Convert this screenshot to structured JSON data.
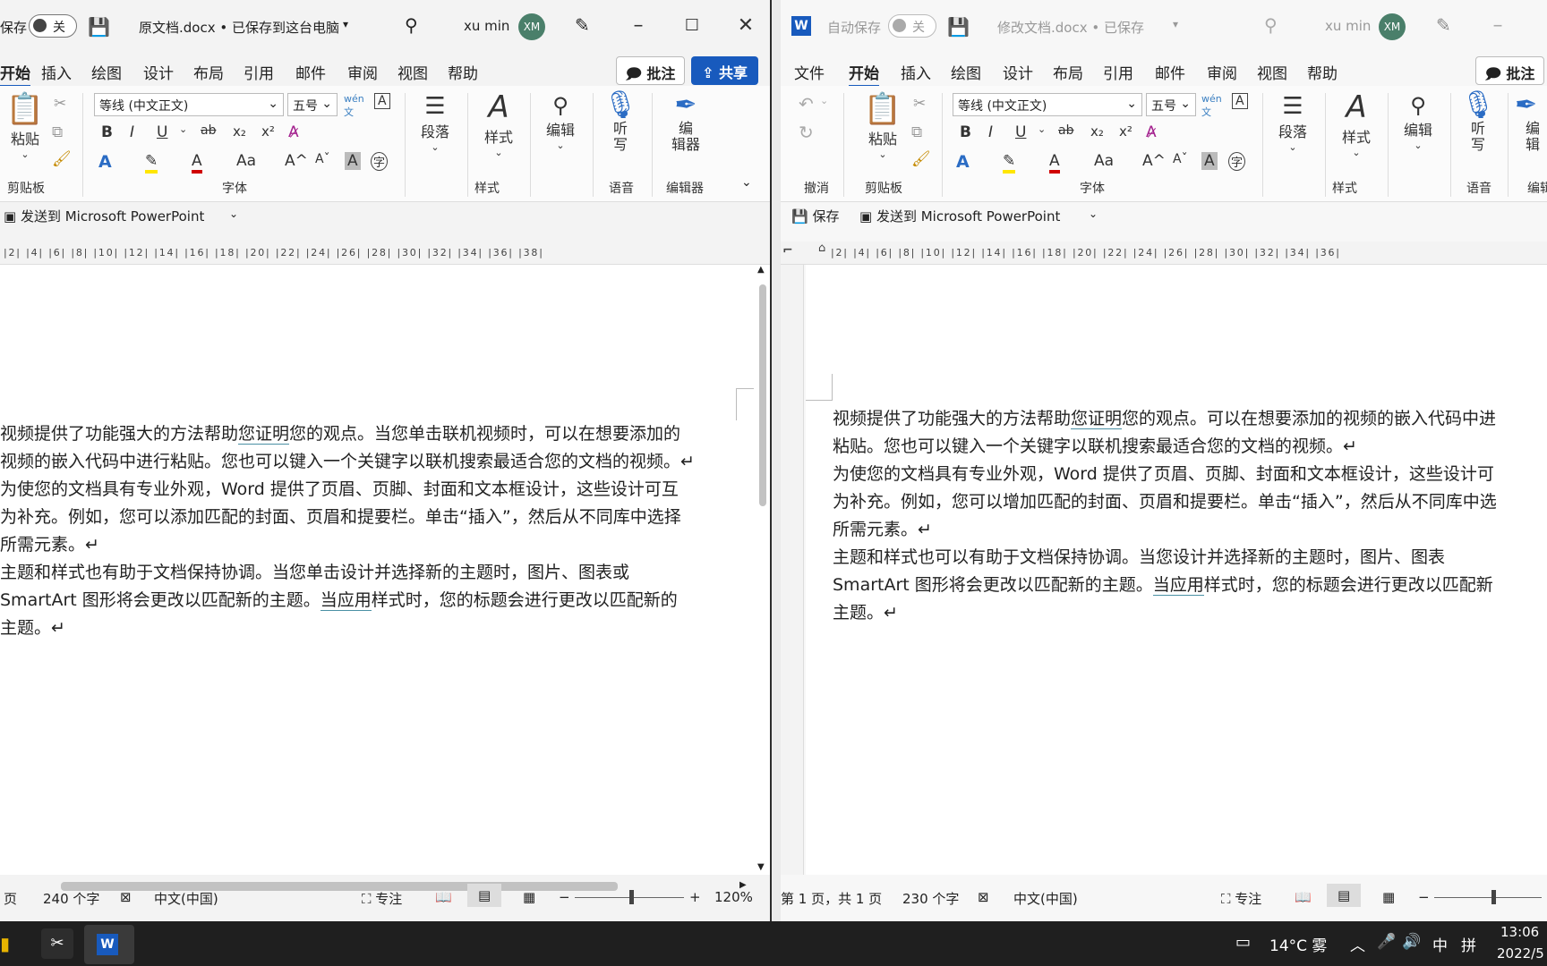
{
  "left": {
    "autosave_label": "保存",
    "toggle_label": "关",
    "doc_title": "原文档.docx • 已保存到这台电脑",
    "user_name": "xu min",
    "avatar_initials": "XM",
    "menu": [
      "开始",
      "插入",
      "绘图",
      "设计",
      "布局",
      "引用",
      "邮件",
      "审阅",
      "视图",
      "帮助"
    ],
    "comment_label": "批注",
    "share_label": "共享",
    "font_name": "等线 (中文正文)",
    "font_size": "五号",
    "paste_label": "粘贴",
    "paragraph_label": "段落",
    "styles_label": "样式",
    "editing_label": "编辑",
    "dictate_label": "听\n写",
    "editor_label": "编\n辑器",
    "groups": [
      "剪贴板",
      "字体",
      "样式",
      "语音",
      "编辑器"
    ],
    "qat_send": "发送到 Microsoft PowerPoint",
    "ruler": "|2| |4| |6| |8| |10| |12| |14| |16| |18| |20| |22| |24| |26| |28| |30| |32| |34| |36| |38|",
    "paragraphs": [
      [
        "视频提供了功能强大的方法帮助",
        "您证明",
        "您的观点。当您单击联机视频时，可以在想要添加的"
      ],
      [
        "视频的嵌入代码中进行粘贴。您也可以键入一个关键字以联机搜索最适合您的文档的视频。↵"
      ],
      [
        "为使您的文档具有专业外观，Word 提供了页眉、页脚、封面和文本框设计，这些设计可互"
      ],
      [
        "为补充。例如，您可以添加匹配的封面、页眉和提要栏。单击“插入”，然后从不同库中选择"
      ],
      [
        "所需元素。↵"
      ],
      [
        "主题和样式也有助于文档保持协调。当您单击设计并选择新的主题时，图片、图表或"
      ],
      [
        "SmartArt 图形将会更改以匹配新的主题。",
        "当应用",
        "样式时，您的标题会进行更改以匹配新的"
      ],
      [
        "主题。↵"
      ]
    ],
    "status_page": "页",
    "status_words": "240 个字",
    "status_lang": "中文(中国)",
    "status_focus": "专注",
    "status_zoom": "120%"
  },
  "right": {
    "autosave_label": "自动保存",
    "toggle_label": "关",
    "doc_title": "修改文档.docx • 已保存",
    "user_name": "xu min",
    "avatar_initials": "XM",
    "menu": [
      "文件",
      "开始",
      "插入",
      "绘图",
      "设计",
      "布局",
      "引用",
      "邮件",
      "审阅",
      "视图",
      "帮助"
    ],
    "comment_label": "批注",
    "font_name": "等线 (中文正文)",
    "font_size": "五号",
    "paste_label": "粘贴",
    "paragraph_label": "段落",
    "styles_label": "样式",
    "editing_label": "编辑",
    "dictate_label": "听\n写",
    "editor_label": "编\n辑",
    "groups": [
      "撤消",
      "剪贴板",
      "字体",
      "样式",
      "语音",
      "编辑"
    ],
    "qat_save": "保存",
    "qat_send": "发送到 Microsoft PowerPoint",
    "ruler": "|2| |4| |6| |8| |10| |12| |14| |16| |18| |20| |22| |24| |26| |28| |30| |32| |34| |36|",
    "paragraphs": [
      [
        "视频提供了功能强大的方法帮助",
        "您证明",
        "您的观点。可以在想要添加的视频的嵌入代码中进"
      ],
      [
        "粘贴。您也可以键入一个关键字以联机搜索最适合您的文档的视频。↵"
      ],
      [
        "为使您的文档具有专业外观，Word 提供了页眉、页脚、封面和文本框设计，这些设计可"
      ],
      [
        "为补充。例如，您可以增加匹配的封面、页眉和提要栏。单击“插入”，然后从不同库中选"
      ],
      [
        "所需元素。↵"
      ],
      [
        "主题和样式也可以有助于文档保持协调。当您设计并选择新的主题时，图片、图表"
      ],
      [
        "SmartArt 图形将会更改以匹配新的主题。",
        "当应用",
        "样式时，您的标题会进行更改以匹配新"
      ],
      [
        "主题。↵"
      ]
    ],
    "status_page": "第 1 页，共 1 页",
    "status_words": "230 个字",
    "status_lang": "中文(中国)",
    "status_focus": "专注"
  },
  "taskbar": {
    "weather": "14°C 雾",
    "ime_lang": "中",
    "ime_mode": "拼",
    "time": "13:06",
    "date": "2022/5"
  }
}
